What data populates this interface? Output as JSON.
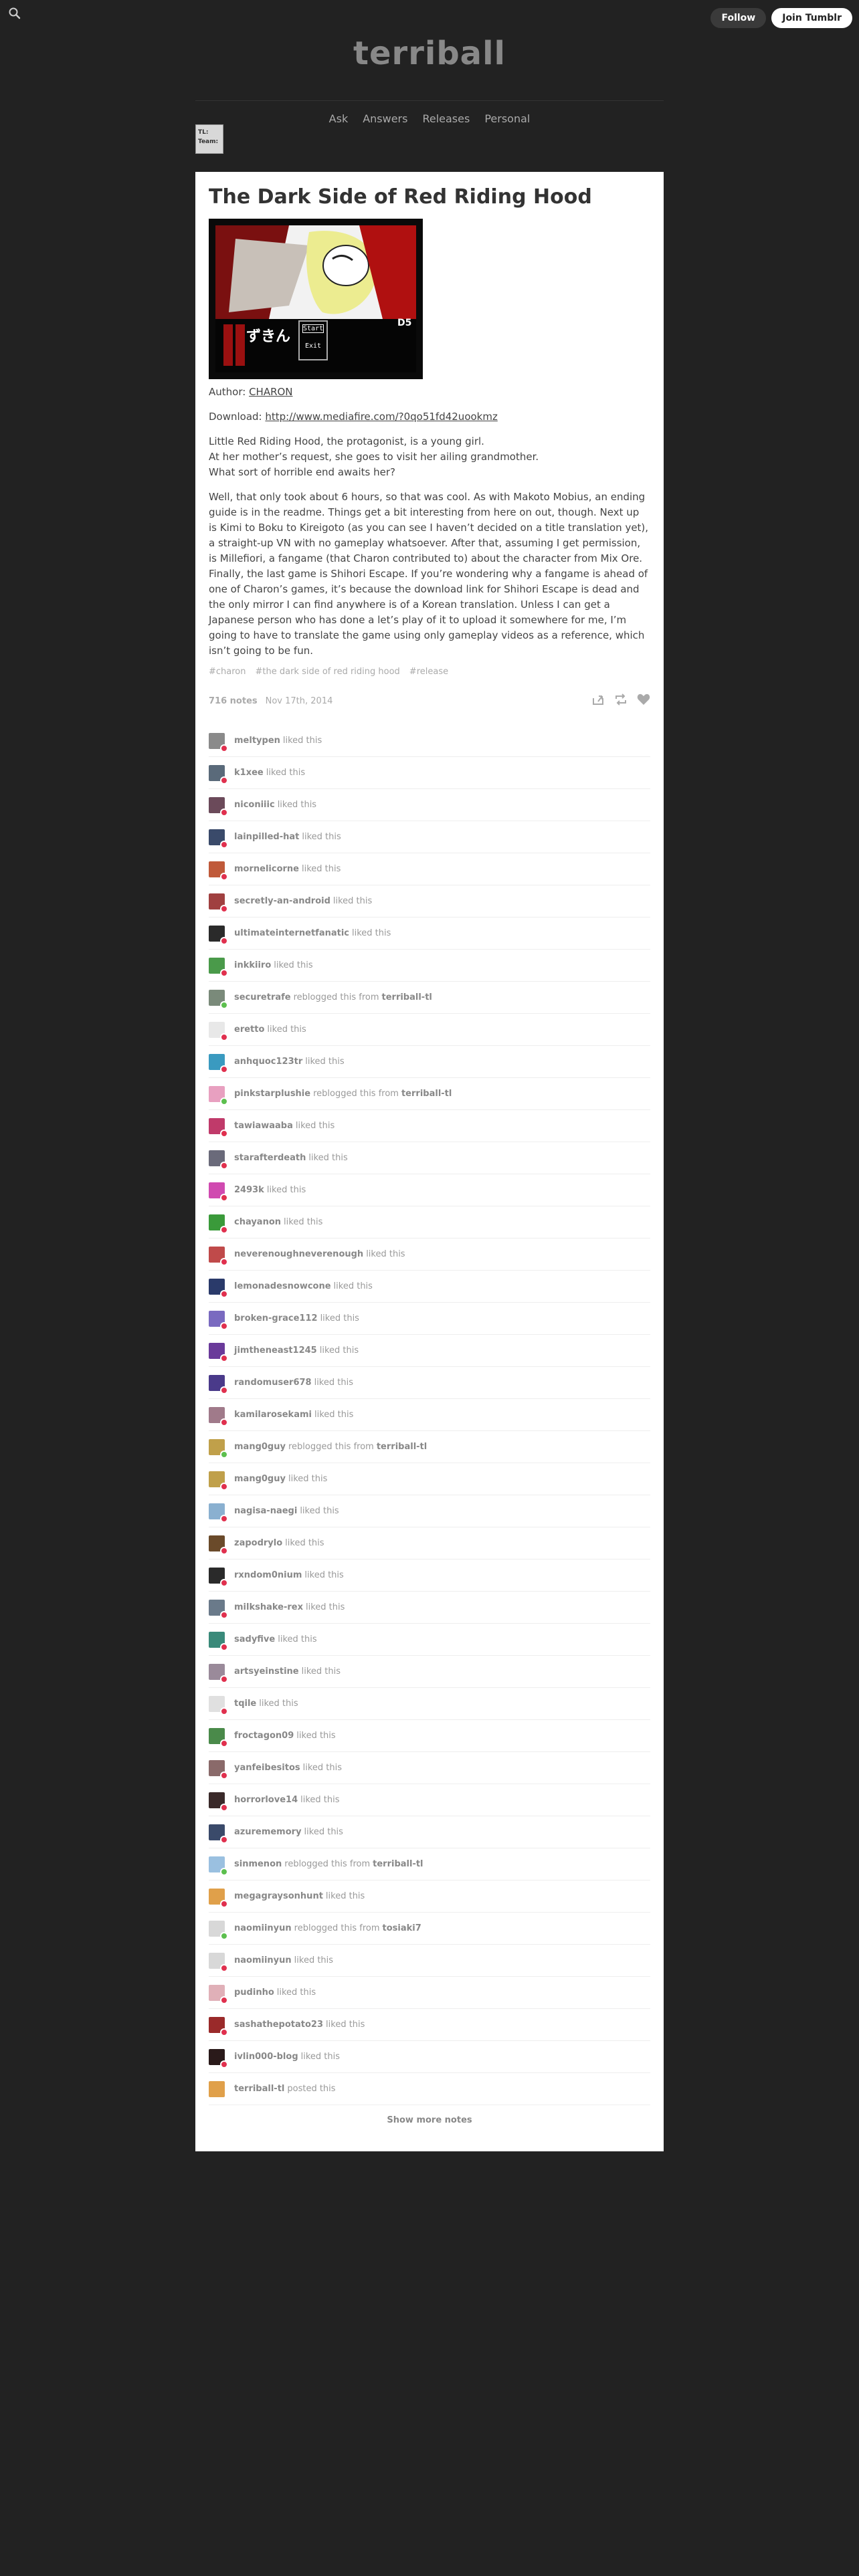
{
  "topbar": {
    "search_icon": "search-icon",
    "follow_label": "Follow",
    "join_label": "Join Tumblr"
  },
  "header": {
    "site_title": "terriball",
    "nav": [
      "Ask",
      "Answers",
      "Releases",
      "Personal"
    ],
    "widget_lines": [
      "TL:",
      "Team:"
    ]
  },
  "post": {
    "title": "The Dark Side of Red Riding Hood",
    "image_texts": {
      "logo": "ずきん",
      "start": "Start",
      "exit": "Exit",
      "label": "D5"
    },
    "author_label": "Author: ",
    "author_name": "CHARON",
    "download_label": "Download: ",
    "download_url": "http://www.mediafire.com/?0qo51fd42uookmz",
    "synopsis": [
      "Little Red Riding Hood, the protagonist, is a young girl.",
      "At her mother’s request, she goes to visit her ailing grandmother.",
      "What sort of horrible end awaits her?"
    ],
    "body": "Well, that only took about 6 hours, so that was cool. As with Makoto Mobius, an ending guide is in the readme. Things get a bit interesting from here on out, though. Next up is Kimi to Boku to Kireigoto (as you can see I haven’t decided on a title translation yet), a straight-up VN with no gameplay whatsoever. After that, assuming I get permission, is Millefiori, a fangame (that Charon contributed to) about the character from Mix Ore. Finally, the last game is Shihori Escape. If you’re wondering why a fangame is ahead of one of Charon’s games, it’s because the download link for Shihori Escape is dead and the only mirror I can find anywhere is of a Korean translation. Unless I can get a Japanese person who has done a let’s play of it to upload it somewhere for me, I’m going to have to translate the game using only gameplay videos as a reference, which isn’t going to be fun.",
    "tags": [
      "#charon",
      "#the dark side of red riding hood",
      "#release"
    ],
    "notes_count": "716 notes",
    "date": "Nov 17th, 2014",
    "action_icons": [
      "share-icon",
      "reblog-icon",
      "heart-icon"
    ]
  },
  "notes": [
    {
      "user": "meltypen",
      "action": "liked this",
      "type": "like",
      "color": "#8a8a8a"
    },
    {
      "user": "k1xee",
      "action": "liked this",
      "type": "like",
      "color": "#5a6a7a"
    },
    {
      "user": "niconiiic",
      "action": "liked this",
      "type": "like",
      "color": "#6b4a5a"
    },
    {
      "user": "lainpilled-hat",
      "action": "liked this",
      "type": "like",
      "color": "#3a4a6a"
    },
    {
      "user": "mornelicorne",
      "action": "liked this",
      "type": "like",
      "color": "#c05a3a"
    },
    {
      "user": "secretly-an-android",
      "action": "liked this",
      "type": "like",
      "color": "#a04040"
    },
    {
      "user": "ultimateinternetfanatic",
      "action": "liked this",
      "type": "like",
      "color": "#2a2a2a"
    },
    {
      "user": "inkkiiro",
      "action": "liked this",
      "type": "like",
      "color": "#4a9a4a"
    },
    {
      "user": "securetrafe",
      "action": "reblogged this from",
      "source": "terriball-tl",
      "type": "reblog",
      "color": "#7a8a7a"
    },
    {
      "user": "eretto",
      "action": "liked this",
      "type": "like",
      "color": "#e8e8e8"
    },
    {
      "user": "anhquoc123tr",
      "action": "liked this",
      "type": "like",
      "color": "#3a9ac0"
    },
    {
      "user": "pinkstarplushie",
      "action": "reblogged this from",
      "source": "terriball-tl",
      "type": "reblog",
      "color": "#e8a0c0"
    },
    {
      "user": "tawiawaaba",
      "action": "liked this",
      "type": "like",
      "color": "#c03a6a"
    },
    {
      "user": "starafterdeath",
      "action": "liked this",
      "type": "like",
      "color": "#6a6a7a"
    },
    {
      "user": "2493k",
      "action": "liked this",
      "type": "like",
      "color": "#d04ab0"
    },
    {
      "user": "chayanon",
      "action": "liked this",
      "type": "like",
      "color": "#3a9a3a"
    },
    {
      "user": "neverenoughneverenough",
      "action": "liked this",
      "type": "like",
      "color": "#c04a4a"
    },
    {
      "user": "lemonadesnowcone",
      "action": "liked this",
      "type": "like",
      "color": "#2a3a6a"
    },
    {
      "user": "broken-grace112",
      "action": "liked this",
      "type": "like",
      "color": "#7a6ac0"
    },
    {
      "user": "jimtheneast1245",
      "action": "liked this",
      "type": "like",
      "color": "#6a3a9a"
    },
    {
      "user": "randomuser678",
      "action": "liked this",
      "type": "like",
      "color": "#4a3a8a"
    },
    {
      "user": "kamilarosekami",
      "action": "liked this",
      "type": "like",
      "color": "#a07a8a"
    },
    {
      "user": "mang0guy",
      "action": "reblogged this from",
      "source": "terriball-tl",
      "type": "reblog",
      "color": "#c0a04a"
    },
    {
      "user": "mang0guy",
      "action": "liked this",
      "type": "like",
      "color": "#c0a04a"
    },
    {
      "user": "nagisa-naegi",
      "action": "liked this",
      "type": "like",
      "color": "#8ab0d0"
    },
    {
      "user": "zapodrylo",
      "action": "liked this",
      "type": "like",
      "color": "#6a4a2a"
    },
    {
      "user": "rxndom0nium",
      "action": "liked this",
      "type": "like",
      "color": "#2a2a2a"
    },
    {
      "user": "milkshake-rex",
      "action": "liked this",
      "type": "like",
      "color": "#6a7a8a"
    },
    {
      "user": "sadyfive",
      "action": "liked this",
      "type": "like",
      "color": "#3a8a7a"
    },
    {
      "user": "artsyeinstine",
      "action": "liked this",
      "type": "like",
      "color": "#9a8a9a"
    },
    {
      "user": "tqile",
      "action": "liked this",
      "type": "like",
      "color": "#e0e0e0"
    },
    {
      "user": "froctagon09",
      "action": "liked this",
      "type": "like",
      "color": "#4a8a4a"
    },
    {
      "user": "yanfeibesitos",
      "action": "liked this",
      "type": "like",
      "color": "#8a6a6a"
    },
    {
      "user": "horrorlove14",
      "action": "liked this",
      "type": "like",
      "color": "#3a2a2a"
    },
    {
      "user": "azurememory",
      "action": "liked this",
      "type": "like",
      "color": "#3a4a6a"
    },
    {
      "user": "sinmenon",
      "action": "reblogged this from",
      "source": "terriball-tl",
      "type": "reblog",
      "color": "#9ac0e0"
    },
    {
      "user": "megagraysonhunt",
      "action": "liked this",
      "type": "like",
      "color": "#e0a04a"
    },
    {
      "user": "naomiinyun",
      "action": "reblogged this from",
      "source": "tosiaki7",
      "type": "reblog",
      "color": "#d8d8d8"
    },
    {
      "user": "naomiinyun",
      "action": "liked this",
      "type": "like",
      "color": "#d8d8d8"
    },
    {
      "user": "pudinho",
      "action": "liked this",
      "type": "like",
      "color": "#e0b0b8"
    },
    {
      "user": "sashathepotato23",
      "action": "liked this",
      "type": "like",
      "color": "#9a2a2a"
    },
    {
      "user": "ivlin000-blog",
      "action": "liked this",
      "type": "like",
      "color": "#2a1a1a"
    },
    {
      "user": "terriball-tl",
      "action": "posted this",
      "type": "post",
      "color": "#e0a04a"
    }
  ],
  "show_more_label": "Show more notes"
}
